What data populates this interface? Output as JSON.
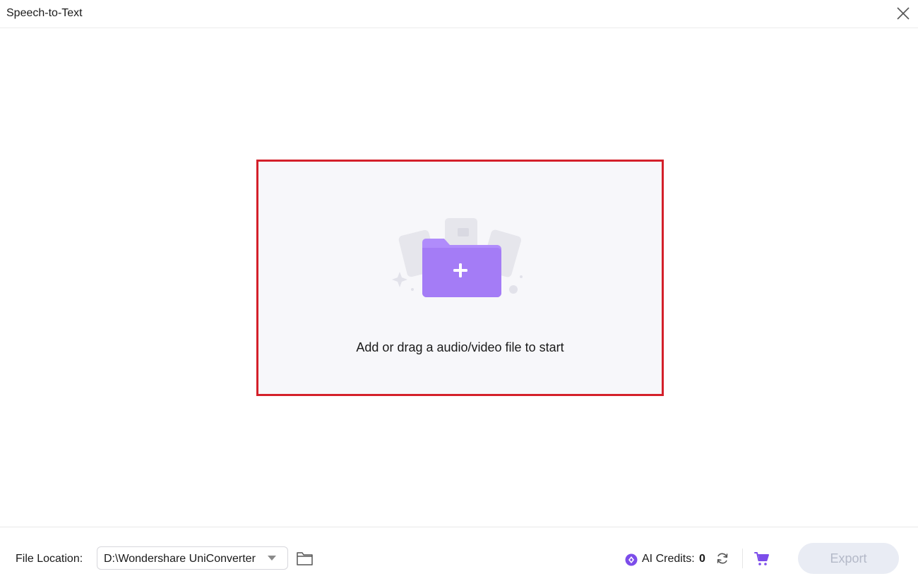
{
  "window": {
    "title": "Speech-to-Text"
  },
  "dropzone": {
    "prompt": "Add or drag a audio/video file to start",
    "highlight_color": "#d4202a"
  },
  "footer": {
    "file_location_label": "File Location:",
    "file_location_value": "D:\\Wondershare UniConverter",
    "ai_credits_label": "AI Credits:",
    "ai_credits_value": "0",
    "export_label": "Export",
    "export_enabled": false
  },
  "icons": {
    "close": "close-icon",
    "folder_add": "folder-add-icon",
    "caret": "chevron-down-icon",
    "browse_folder": "folder-icon",
    "credits": "ai-credits-icon",
    "refresh": "refresh-icon",
    "cart": "cart-icon"
  },
  "colors": {
    "accent": "#8f62f2",
    "folder": "#b08cfb",
    "export_bg": "#e9ecf4",
    "export_text": "#b4b9c8"
  }
}
